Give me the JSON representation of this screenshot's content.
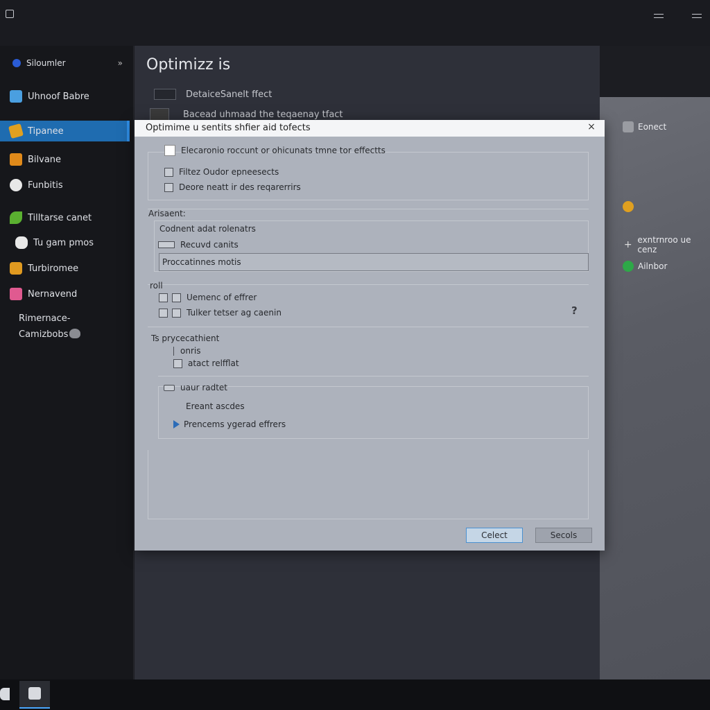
{
  "sidebar": {
    "header": "Siloumler",
    "header_chevron": "»",
    "items": [
      {
        "label": "Uhnoof Babre",
        "icon": "folder-icon",
        "color": "#4a9fe0"
      },
      {
        "label": "Tipanee",
        "icon": "gold-cube-icon",
        "color": "#e0a020"
      },
      {
        "label": "Bilvane",
        "icon": "orange-box-icon",
        "color": "#e08a1a"
      },
      {
        "label": "Funbitis",
        "icon": "hand-icon",
        "color": "#e8e8e8"
      },
      {
        "label": "Tilltarse canet",
        "icon": "green-leaf-icon",
        "color": "#5ab030"
      },
      {
        "label": "Tu gam pmos",
        "icon": "pointer-icon",
        "color": "#e8e8e8"
      },
      {
        "label": "Turbiromee",
        "icon": "amber-gem-icon",
        "color": "#e09a20"
      },
      {
        "label": "Nernavend",
        "icon": "pink-puzzle-icon",
        "color": "#e05a90"
      }
    ],
    "footer_line1": "Rimernace-",
    "footer_line2": "Camizbobs"
  },
  "main": {
    "title": "Optimizz is",
    "row1": "DetaiceSanelt ffect",
    "row2": "Bacead uhmaad the teqaenay tfact"
  },
  "dialog": {
    "title": "Optimime u sentits shfier aid tofects",
    "close": "×",
    "group1": [
      "Elecaronio roccunt or ohicunats tmne tor effectts",
      "Filtez Oudor epneesects",
      "Deore neatt ir des reqarerrirs"
    ],
    "section_adjust": "Arisaent:",
    "adjust_line1": "Codnent adat rolenatrs",
    "adjust_line2": "Recuvd canits",
    "adjust_field": "Proccatinnes motis",
    "section_toll": "roll",
    "toll_items": [
      "Uemenc of effrer",
      "Tulker tetser ag caenin"
    ],
    "help": "?",
    "section_perf": "Ts prycecathient",
    "perf_items": [
      "onris",
      "atact relfflat"
    ],
    "sub_title": "uaur radtet",
    "sub_line1": "Ereant ascdes",
    "sub_line2": "Prencems ygerad effrers",
    "ok": "Celect",
    "cancel": "Secols"
  },
  "right_panel": {
    "items": [
      {
        "label": "Eonect",
        "icon": "share-icon"
      },
      {
        "label": "",
        "icon": "amber-gem-icon"
      },
      {
        "label": "exntrnroo ue cenz",
        "icon": "plus-icon"
      },
      {
        "label": "Ailnbor",
        "icon": "green-circle-icon"
      }
    ]
  }
}
